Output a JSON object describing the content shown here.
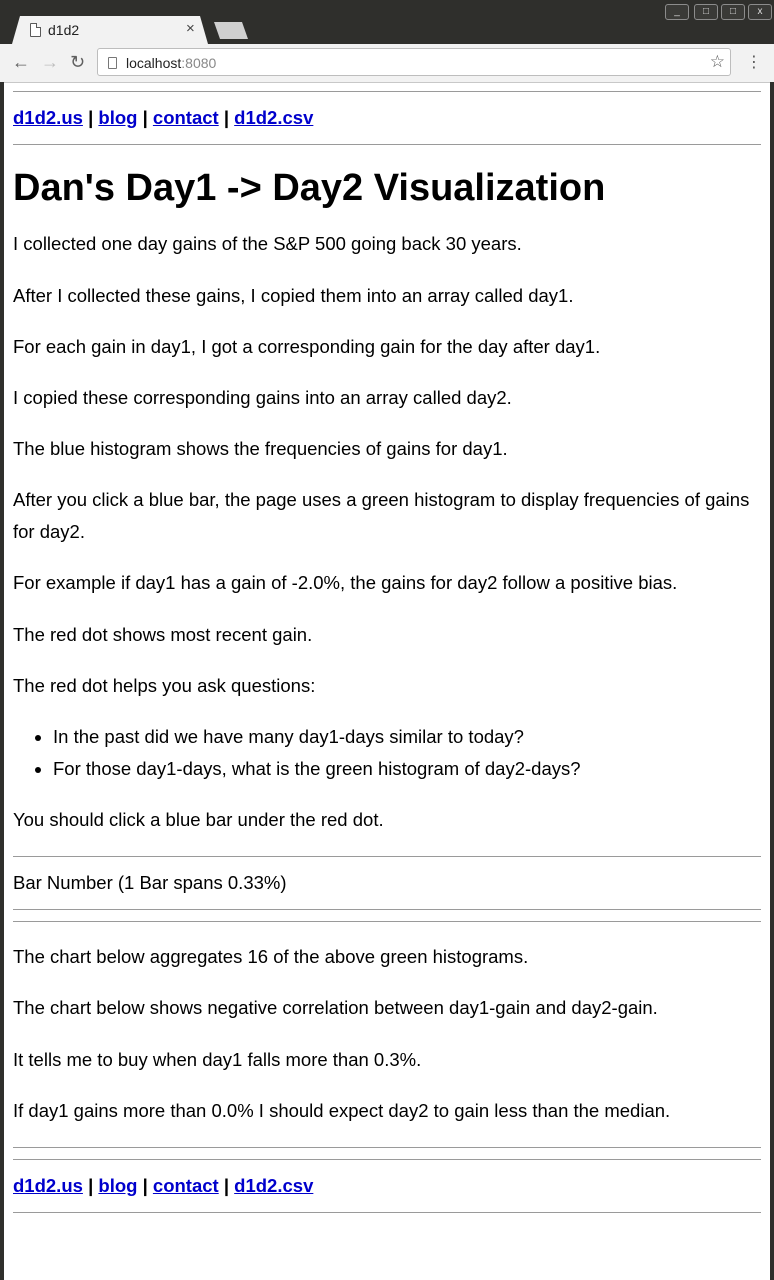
{
  "browser": {
    "tab_title": "d1d2",
    "tab_close": "×",
    "url_host": "localhost",
    "url_port": ":8080",
    "win_buttons": [
      "_",
      "□",
      "□",
      "x"
    ],
    "icons": {
      "back": "back-arrow-icon",
      "forward": "forward-arrow-icon",
      "reload": "reload-icon",
      "star": "star-icon",
      "menu": "kebab-menu-icon"
    }
  },
  "nav": {
    "links": [
      "d1d2.us",
      "blog",
      "contact",
      "d1d2.csv"
    ],
    "separator": "|"
  },
  "page": {
    "title": "Dan's Day1 -> Day2 Visualization",
    "paragraphs": [
      "I collected one day gains of the S&P 500 going back 30 years.",
      "After I collected these gains, I copied them into an array called day1.",
      "For each gain in day1, I got a corresponding gain for the day after day1.",
      "I copied these corresponding gains into an array called day2.",
      "The blue histogram shows the frequencies of gains for day1.",
      "After you click a blue bar, the page uses a green histogram to display frequencies of gains for day2.",
      "For example if day1 has a gain of -2.0%, the gains for day2 follow a positive bias.",
      "The red dot shows most recent gain.",
      "The red dot helps you ask questions:"
    ],
    "questions": [
      "In the past did we have many day1-days similar to today?",
      "For those day1-days, what is the green histogram of day2-days?"
    ],
    "instruction": "You should click a blue bar under the red dot.",
    "bar_number": "Bar Number (1 Bar spans 0.33%)",
    "aggregate_paragraphs": [
      "The chart below aggregates 16 of the above green histograms.",
      "The chart below shows negative correlation between day1-gain and day2-gain.",
      "It tells me to buy when day1 falls more than 0.3%.",
      "If day1 gains more than 0.0% I should expect day2 to gain less than the median."
    ]
  },
  "colors": {
    "link": "#0000cc",
    "chrome": "#2f2f2c",
    "toolbar": "#f2f2f2"
  }
}
